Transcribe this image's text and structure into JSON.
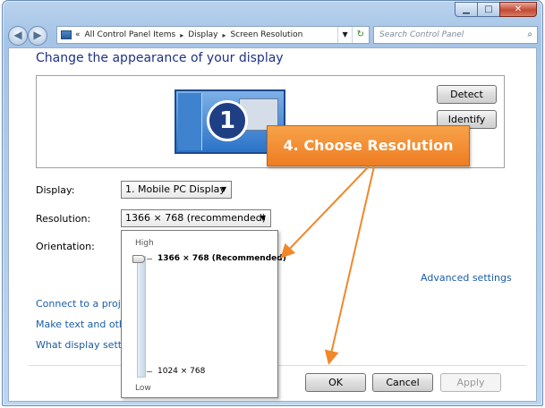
{
  "window": {
    "minimize": "▁",
    "maximize": "□",
    "close": "✕"
  },
  "nav": {
    "back_icon": "◀",
    "forward_icon": "▶",
    "breadcrumb": [
      "All Control Panel Items",
      "Display",
      "Screen Resolution"
    ],
    "chevrons": "«",
    "sep": "▸",
    "search_placeholder": "Search Control Panel"
  },
  "page": {
    "title": "Change the appearance of your display",
    "monitor_number": "1",
    "detect_label": "Detect",
    "identify_label": "Identify"
  },
  "settings": {
    "display_label": "Display:",
    "display_value": "1. Mobile PC Display",
    "resolution_label": "Resolution:",
    "resolution_value": "1366 × 768 (recommended)",
    "orientation_label": "Orientation:",
    "advanced_link": "Advanced settings"
  },
  "links": [
    "Connect to a projector",
    "Make text and other items larger or smaller",
    "What display settings should I choose?"
  ],
  "dropdown": {
    "high_label": "High",
    "low_label": "Low",
    "top_option": "1366 × 768 (Recommended)",
    "bottom_option": "1024 × 768",
    "slider_level": 1.0
  },
  "buttons": {
    "ok": "OK",
    "cancel": "Cancel",
    "apply": "Apply"
  },
  "callout": {
    "text": "4. Choose Resolution",
    "color": "#f18a2c"
  }
}
